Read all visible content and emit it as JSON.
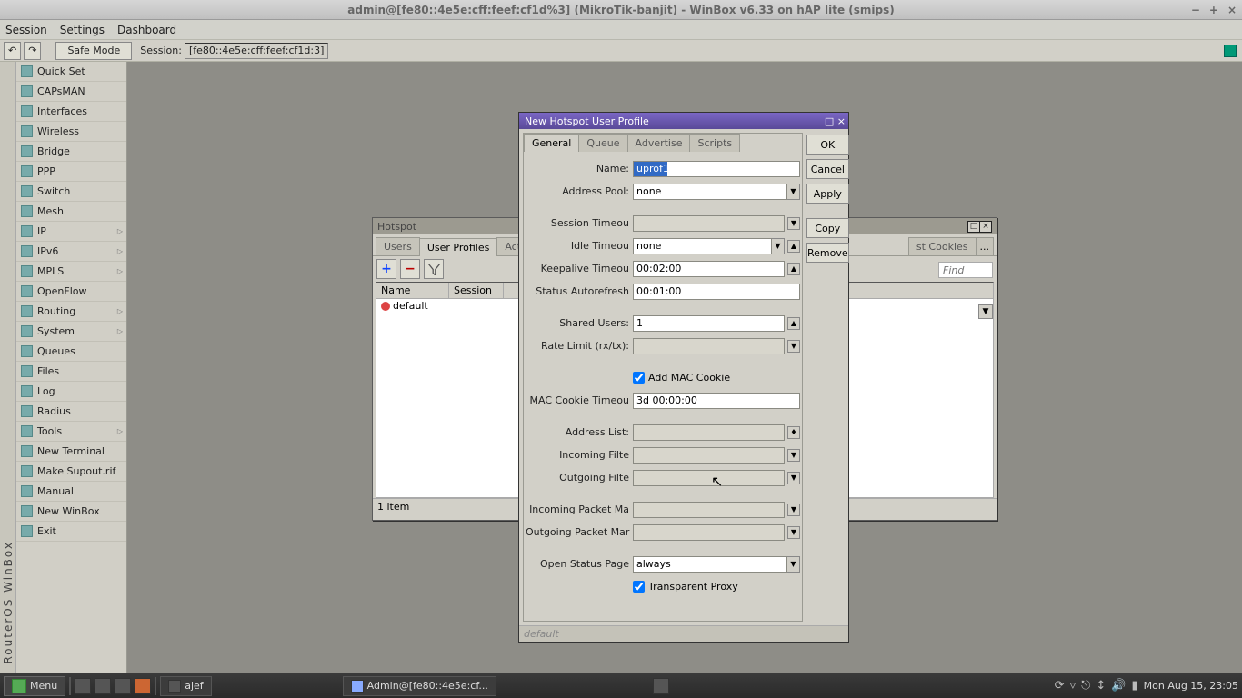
{
  "os": {
    "title": "admin@[fe80::4e5e:cff:feef:cf1d%3] (MikroTik-banjit) - WinBox v6.33 on hAP lite (smips)",
    "menu": {
      "session": "Session",
      "settings": "Settings",
      "dashboard": "Dashboard"
    }
  },
  "wb_toolbar": {
    "undo": "↶",
    "redo": "↷",
    "safe_mode": "Safe Mode",
    "session_label": "Session:",
    "session_value": "[fe80::4e5e:cff:feef:cf1d:3]"
  },
  "sidebar": {
    "vlabel": "RouterOS WinBox",
    "items": [
      {
        "label": "Quick Set"
      },
      {
        "label": "CAPsMAN"
      },
      {
        "label": "Interfaces"
      },
      {
        "label": "Wireless"
      },
      {
        "label": "Bridge"
      },
      {
        "label": "PPP"
      },
      {
        "label": "Switch"
      },
      {
        "label": "Mesh"
      },
      {
        "label": "IP",
        "sub": true
      },
      {
        "label": "IPv6",
        "sub": true
      },
      {
        "label": "MPLS",
        "sub": true
      },
      {
        "label": "OpenFlow"
      },
      {
        "label": "Routing",
        "sub": true
      },
      {
        "label": "System",
        "sub": true
      },
      {
        "label": "Queues"
      },
      {
        "label": "Files"
      },
      {
        "label": "Log"
      },
      {
        "label": "Radius"
      },
      {
        "label": "Tools",
        "sub": true
      },
      {
        "label": "New Terminal"
      },
      {
        "label": "Make Supout.rif"
      },
      {
        "label": "Manual"
      },
      {
        "label": "New WinBox"
      },
      {
        "label": "Exit"
      }
    ]
  },
  "hotspot": {
    "title": "Hotspot",
    "tabs": {
      "users": "Users",
      "user_profiles": "User Profiles",
      "active": "Active",
      "cookies": "st Cookies",
      "ell": "..."
    },
    "toolbar": {
      "add": "+",
      "remove": "−",
      "filter": "▾"
    },
    "find_placeholder": "Find",
    "columns": {
      "name": "Name",
      "session": "Session"
    },
    "row1": "default",
    "status": "1 item"
  },
  "dialog": {
    "title": "New Hotspot User Profile",
    "tabs": {
      "general": "General",
      "queue": "Queue",
      "advertise": "Advertise",
      "scripts": "Scripts"
    },
    "buttons": {
      "ok": "OK",
      "cancel": "Cancel",
      "apply": "Apply",
      "copy": "Copy",
      "remove": "Remove"
    },
    "labels": {
      "name": "Name:",
      "address_pool": "Address Pool:",
      "session_timeout": "Session Timeou",
      "idle_timeout": "Idle Timeou",
      "keepalive": "Keepalive Timeou",
      "autorefresh": "Status Autorefresh",
      "shared": "Shared Users:",
      "rate": "Rate Limit (rx/tx):",
      "addmac": "Add MAC Cookie",
      "mac_timeout": "MAC Cookie Timeou",
      "addr_list": "Address List:",
      "in_filter": "Incoming Filte",
      "out_filter": "Outgoing Filte",
      "in_mark": "Incoming Packet Ma",
      "out_mark": "Outgoing Packet Mar",
      "open_status": "Open Status Page",
      "transparent": "Transparent Proxy"
    },
    "values": {
      "name": "uprof1",
      "address_pool": "none",
      "idle_timeout": "none",
      "keepalive": "00:02:00",
      "autorefresh": "00:01:00",
      "shared": "1",
      "mac_timeout": "3d 00:00:00",
      "open_status": "always"
    },
    "status": "default"
  },
  "taskbar": {
    "menu": "Menu",
    "item_ajef": "ajef",
    "item_winbox": "Admin@[fe80::4e5e:cf...",
    "clock": "Mon Aug 15, 23:05"
  }
}
